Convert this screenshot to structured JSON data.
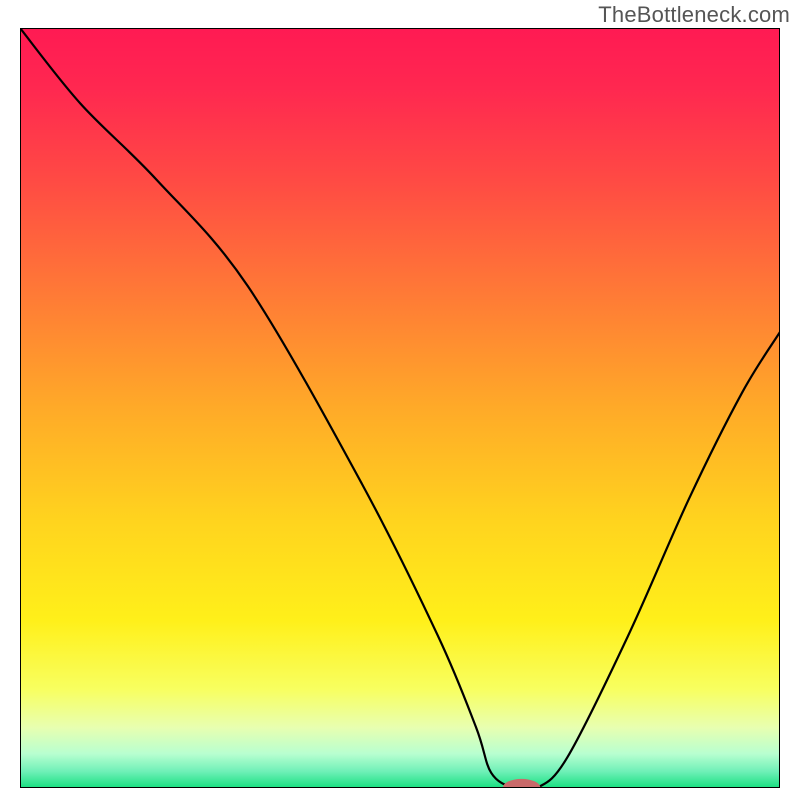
{
  "watermark": "TheBottleneck.com",
  "chart_data": {
    "type": "line",
    "title": "",
    "xlabel": "",
    "ylabel": "",
    "xlim": [
      0,
      100
    ],
    "ylim": [
      0,
      100
    ],
    "series": [
      {
        "name": "curve",
        "x": [
          0,
          8,
          18,
          30,
          45,
          55,
          60,
          62,
          65,
          68,
          72,
          80,
          88,
          95,
          100
        ],
        "y": [
          100,
          90,
          80,
          66,
          40,
          20,
          8,
          2,
          0,
          0,
          4,
          20,
          38,
          52,
          60
        ]
      }
    ],
    "marker": {
      "x": 66,
      "y": 0,
      "color": "#c96a6a",
      "rx": 2.5,
      "ry": 1.2
    },
    "background_gradient": {
      "stops": [
        {
          "offset": 0.0,
          "color": "#ff1a53"
        },
        {
          "offset": 0.08,
          "color": "#ff2850"
        },
        {
          "offset": 0.2,
          "color": "#ff4a44"
        },
        {
          "offset": 0.35,
          "color": "#ff7a36"
        },
        {
          "offset": 0.5,
          "color": "#ffaa28"
        },
        {
          "offset": 0.65,
          "color": "#ffd41e"
        },
        {
          "offset": 0.78,
          "color": "#fff01a"
        },
        {
          "offset": 0.87,
          "color": "#f8ff60"
        },
        {
          "offset": 0.92,
          "color": "#e8ffb0"
        },
        {
          "offset": 0.955,
          "color": "#b8ffd0"
        },
        {
          "offset": 0.978,
          "color": "#70f0b8"
        },
        {
          "offset": 1.0,
          "color": "#18e080"
        }
      ]
    },
    "frame": {
      "stroke": "#000000",
      "stroke_width": 2
    },
    "curve_style": {
      "stroke": "#000000",
      "stroke_width": 2.2
    }
  }
}
